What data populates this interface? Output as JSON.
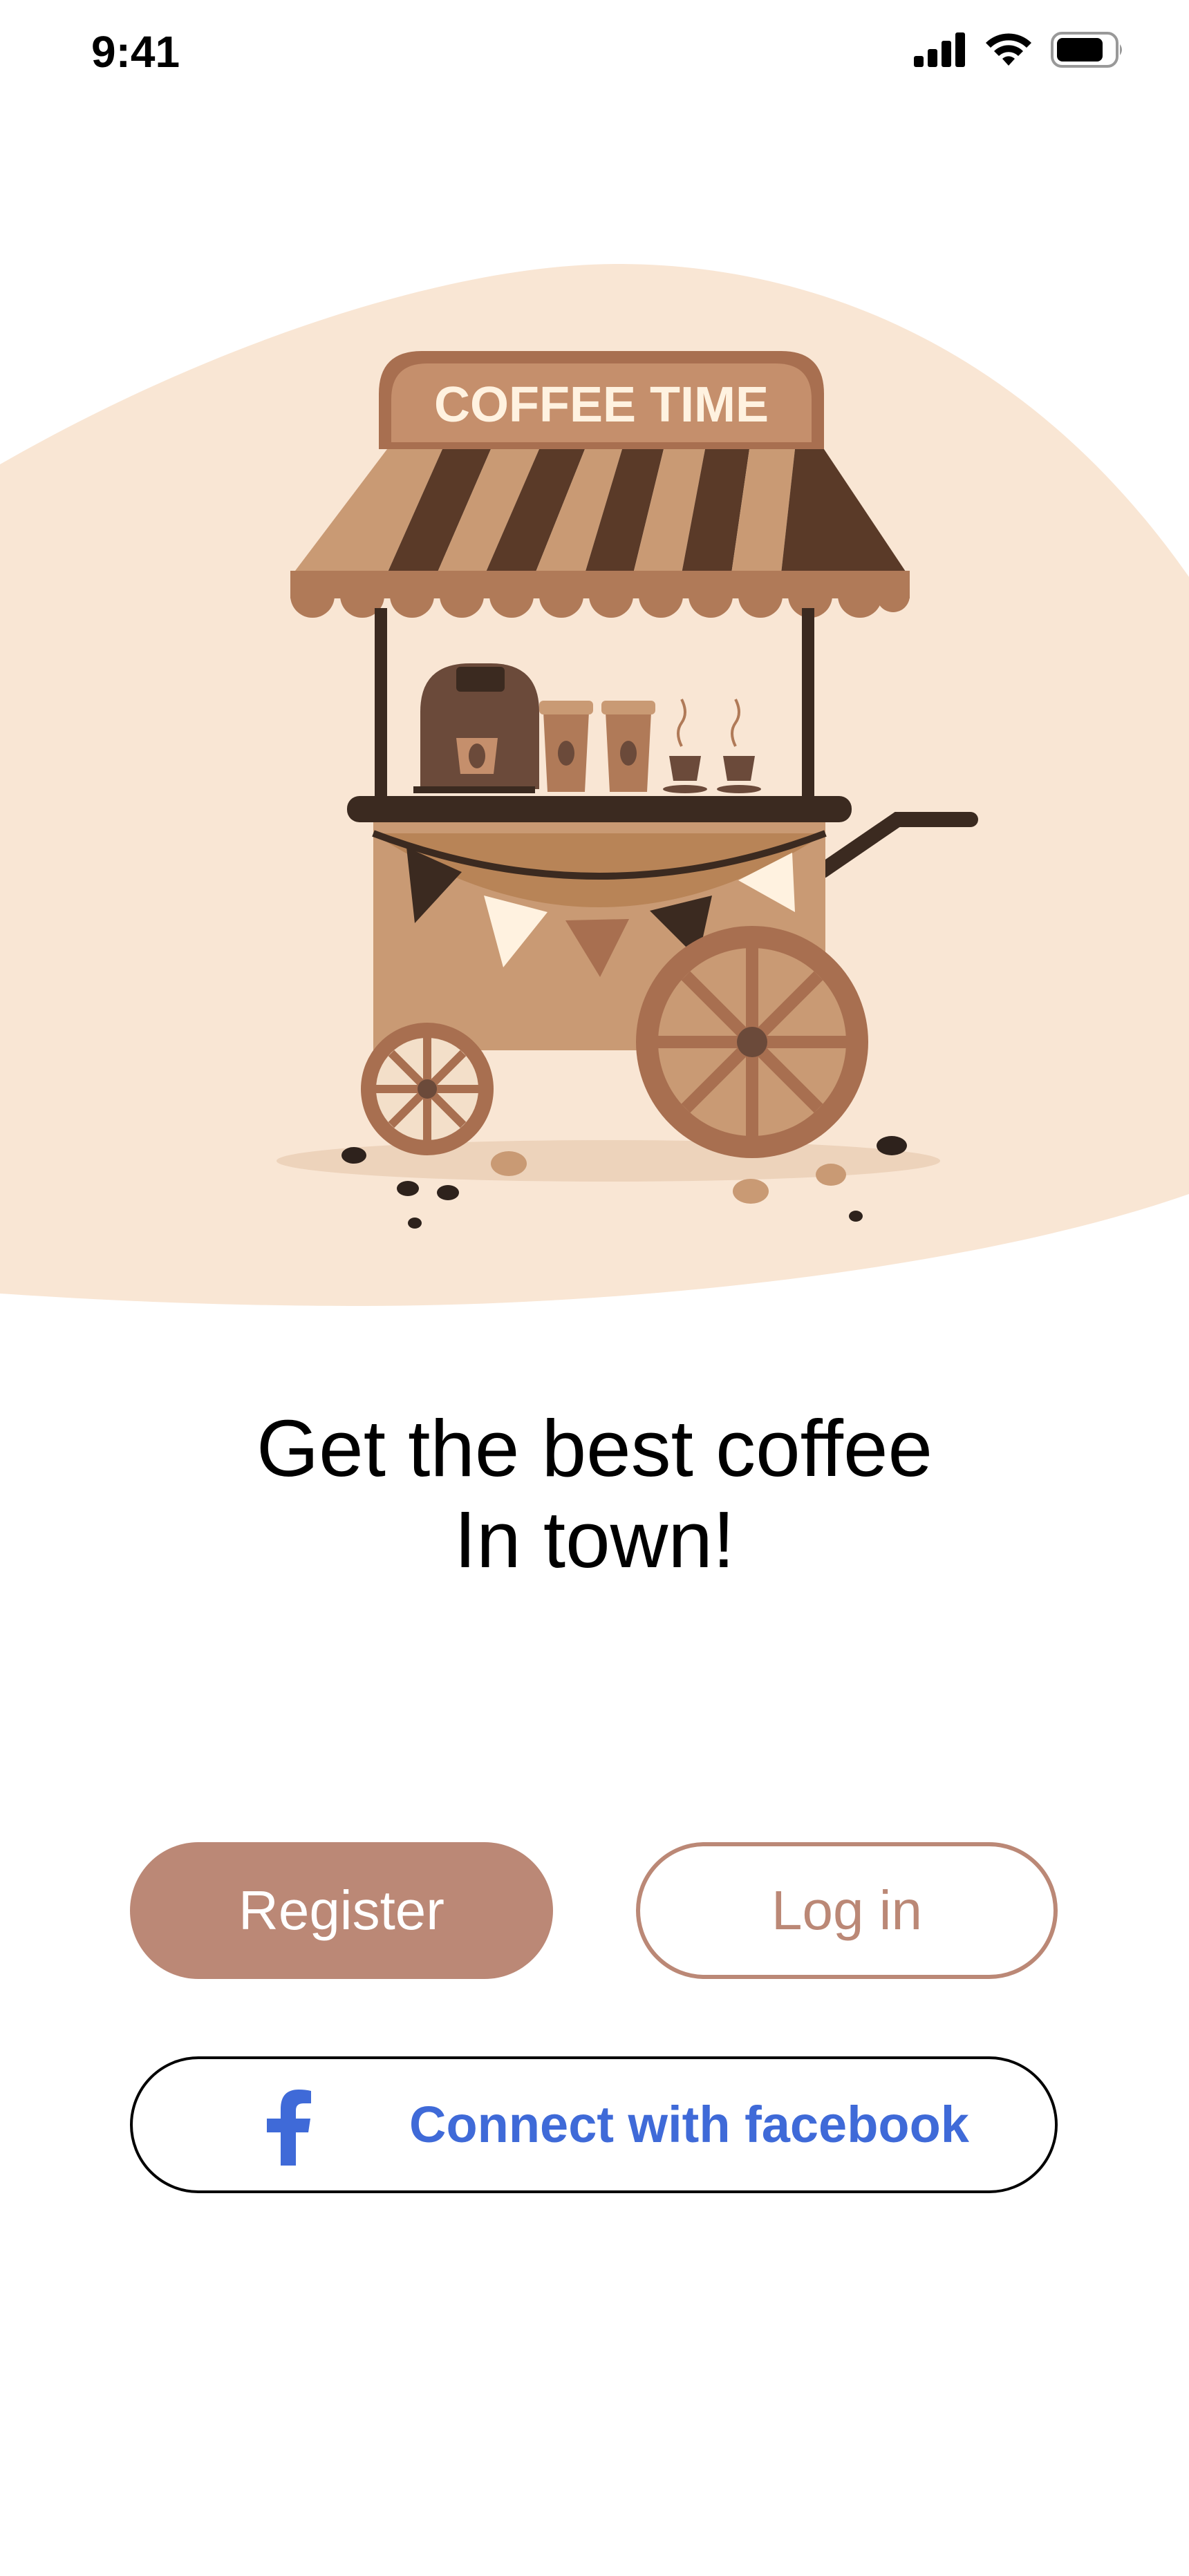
{
  "status_bar": {
    "time": "9:41",
    "icons": [
      "cellular-signal-icon",
      "wifi-icon",
      "battery-icon"
    ]
  },
  "hero": {
    "sign_text": "COFFEE TIME"
  },
  "headline": {
    "line1": "Get the best coffee",
    "line2": "In town!"
  },
  "actions": {
    "register_label": "Register",
    "login_label": "Log in",
    "facebook_label": "Connect with facebook"
  },
  "colors": {
    "accent": "#bb8876",
    "hero_bg": "#f9e6d4",
    "facebook_blue": "#3f6ad8"
  }
}
